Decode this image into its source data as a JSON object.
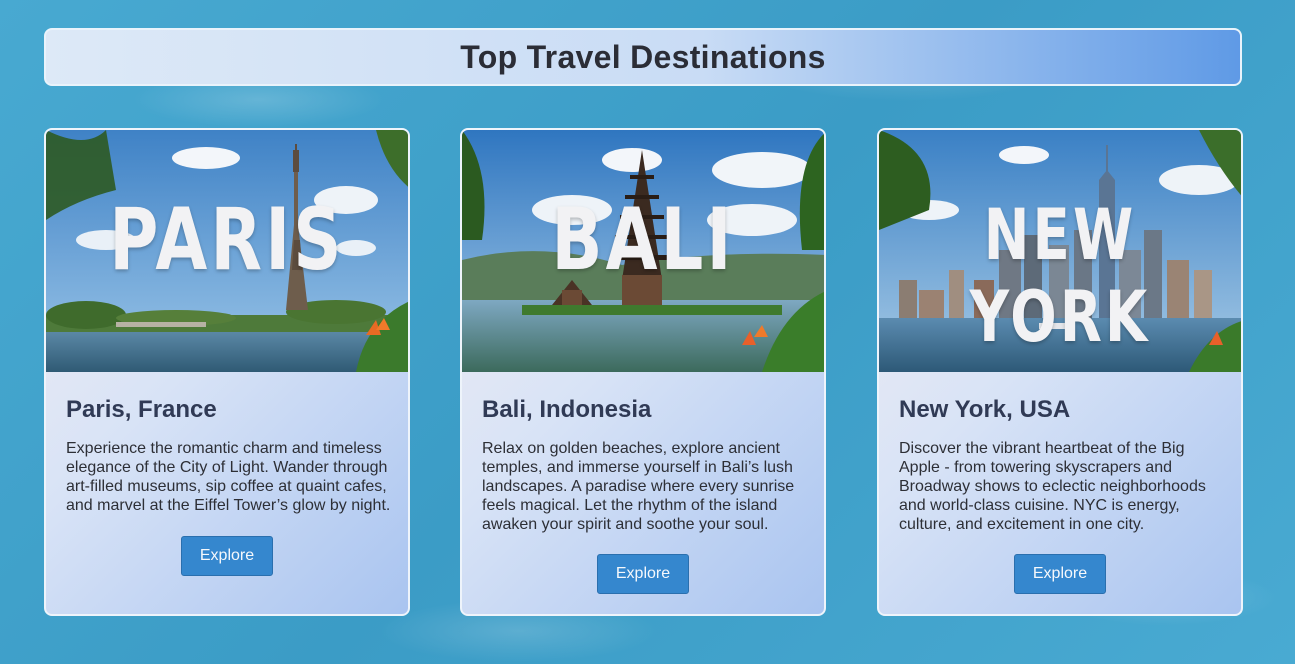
{
  "page": {
    "title": "Top Travel Destinations"
  },
  "cards": [
    {
      "photo_word": "PARIS",
      "title": "Paris, France",
      "description": "Experience the romantic charm and timeless elegance of the City of Light. Wander through art-filled museums, sip coffee at quaint cafes, and marvel at the Eiffel Tower’s glow by night.",
      "button": "Explore"
    },
    {
      "photo_word": "BALI",
      "title": "Bali, Indonesia",
      "description": "Relax on golden beaches, explore ancient temples, and immerse yourself in Bali’s lush landscapes. A paradise where every sunrise feels magical. Let the rhythm of the island awaken your spirit and soothe your soul.",
      "button": "Explore"
    },
    {
      "photo_word": "NEW YORK",
      "title": "New York, USA",
      "description": "Discover the vibrant heartbeat of the Big Apple - from towering skyscrapers and Broadway shows to eclectic neighborhoods and world-class cuisine. NYC is energy, culture, and excitement in one city.",
      "button": "Explore"
    }
  ]
}
